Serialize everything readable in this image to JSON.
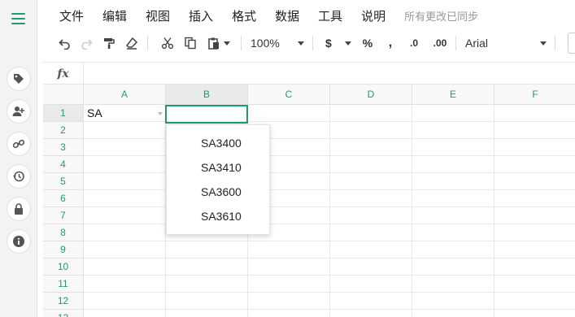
{
  "menu": {
    "items": [
      "文件",
      "编辑",
      "视图",
      "插入",
      "格式",
      "数据",
      "工具",
      "说明"
    ],
    "save_status": "所有更改已同步"
  },
  "toolbar": {
    "zoom": "100%",
    "currency": "$",
    "percent": "%",
    "comma": ",",
    "decrease_decimals": ".0",
    "increase_decimals": ".00",
    "font": "Arial"
  },
  "formula_bar": {
    "label": "fx",
    "value": ""
  },
  "grid": {
    "columns": [
      "A",
      "B",
      "C",
      "D",
      "E",
      "F"
    ],
    "rows": [
      "1",
      "2",
      "3",
      "4",
      "5",
      "6",
      "7",
      "8",
      "9",
      "10",
      "11",
      "12",
      "13"
    ],
    "cells": {
      "A1": "SA"
    },
    "selected_cell": "B1"
  },
  "autocomplete": {
    "options": [
      "SA3400",
      "SA3410",
      "SA3600",
      "SA3610"
    ]
  },
  "colors": {
    "accent": "#1e9b72"
  }
}
